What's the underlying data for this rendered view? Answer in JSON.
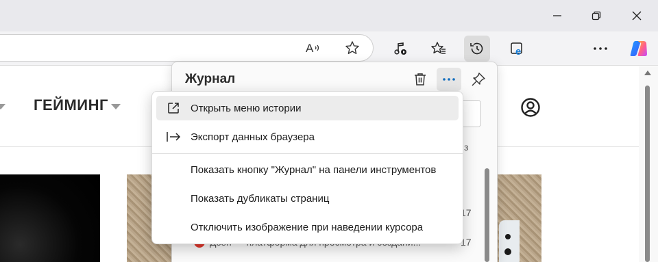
{
  "window_controls": {
    "minimize_icon": "minimize-icon",
    "restore_icon": "restore-icon",
    "close_icon": "close-icon"
  },
  "toolbar": {
    "icons": [
      "read-aloud-icon",
      "favorite-star-icon",
      "media-control-icon",
      "favorites-icon",
      "history-icon",
      "ie-mode-icon",
      "more-icon",
      "copilot-icon"
    ]
  },
  "page": {
    "nav_item": "ГЕЙМИНГ"
  },
  "history_panel": {
    "title": "Журнал",
    "delete_icon": "trash-icon",
    "more_icon": "more-icon",
    "pin_icon": "pin-icon",
    "entries": [
      {
        "time": "17"
      },
      {
        "text": "Дзен — платформа для просмотра и создани...",
        "time": "17"
      }
    ],
    "partial_char": "з"
  },
  "menu": {
    "items": [
      {
        "label": "Открыть меню истории",
        "icon": "open-in-new-icon"
      },
      {
        "label": "Экспорт данных браузера",
        "icon": "export-arrow-icon"
      },
      {
        "label": "Показать кнопку \"Журнал\" на панели инструментов"
      },
      {
        "label": "Показать дубликаты страниц"
      },
      {
        "label": "Отключить изображение при наведении курсора"
      }
    ]
  },
  "colors": {
    "accent": "#0f6cbd",
    "titlebar": "#e9e9ed",
    "menu_hover": "#ececec"
  }
}
